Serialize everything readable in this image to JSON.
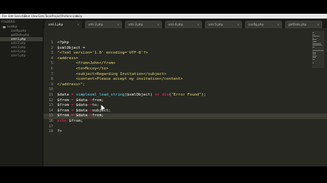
{
  "menu": [
    "File",
    "Edit",
    "Selection",
    "Find",
    "View",
    "Goto",
    "Tools",
    "Project",
    "Preferences",
    "Help"
  ],
  "sidebar": {
    "header": "FOLDERS",
    "folder": "ncddipi",
    "items": [
      "config.php",
      "getData.php",
      "xml-1.php",
      "xml-2.php",
      "xml-3.php",
      "xml-4.php",
      "xml-5.php"
    ],
    "selected_index": 2
  },
  "tabs": [
    {
      "label": "xml-1.php",
      "active": true
    },
    {
      "label": "xml-2.php",
      "active": false
    },
    {
      "label": "xml-3.php",
      "active": false
    },
    {
      "label": "xml-4.php",
      "active": false
    },
    {
      "label": "xml-5.php",
      "active": false
    },
    {
      "label": "config.php",
      "active": false
    },
    {
      "label": "getData.php",
      "active": false
    }
  ],
  "tab_close": "×",
  "editor": {
    "current_line": 15,
    "lines": [
      "<?php",
      "$xmlObject =",
      "\"<?xml version='1.0' encoding='UTF-8'?>",
      "<address>",
      "        <from>John</from>",
      "        <to>Mccoy</to>",
      "        <subject>Regarding Invitation</subject>",
      "        <content>Please accept my invitation</content>",
      "</address>\";",
      "",
      "$data = simplexml_load_string($xmlObject) or die(\"Error Found\");",
      "$from = $data->from;",
      "$from = $data->to;",
      "$from = $data->subject;",
      "$from = $data->from;",
      "echo $from;",
      "",
      "?>"
    ]
  },
  "colors": {
    "background": "#272822",
    "keyword": "#f92672",
    "string": "#e6db74",
    "function": "#66d9ef"
  }
}
